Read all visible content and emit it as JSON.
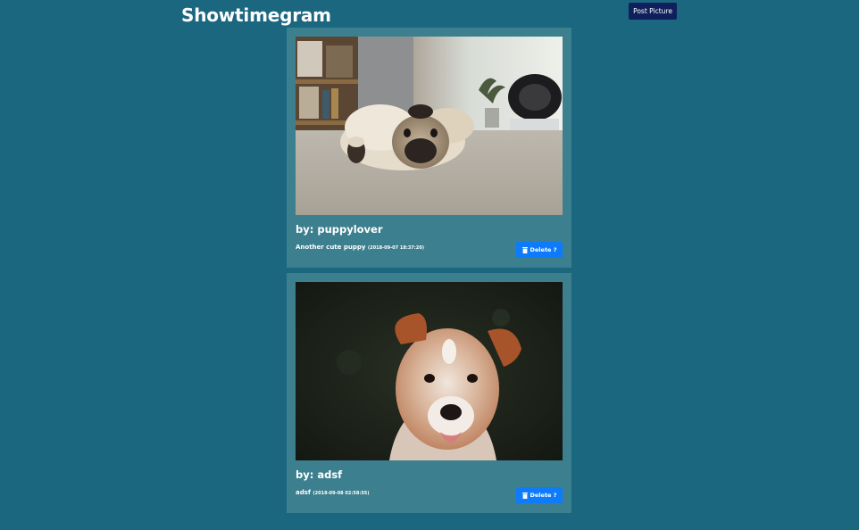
{
  "header": {
    "title": "Showtimegram",
    "post_button_label": "Post Picture"
  },
  "posts": [
    {
      "image_icon": "pug-lying-on-floor-photo",
      "author": "by: puppylover",
      "caption": "Another cute puppy",
      "timestamp": "(2018-09-07 18:37:20)",
      "delete_label": "Delete ?",
      "delete_icon": "trash-icon"
    },
    {
      "image_icon": "brown-puppy-portrait-photo",
      "author": "by: adsf",
      "caption": "adsf",
      "timestamp": "(2018-09-08 02:58:55)",
      "delete_label": "Delete ?",
      "delete_icon": "trash-icon"
    }
  ],
  "colors": {
    "background": "#1b6780",
    "card": "#3c7f8e",
    "post_button": "#10205c",
    "delete_button": "#0d7bfc"
  }
}
